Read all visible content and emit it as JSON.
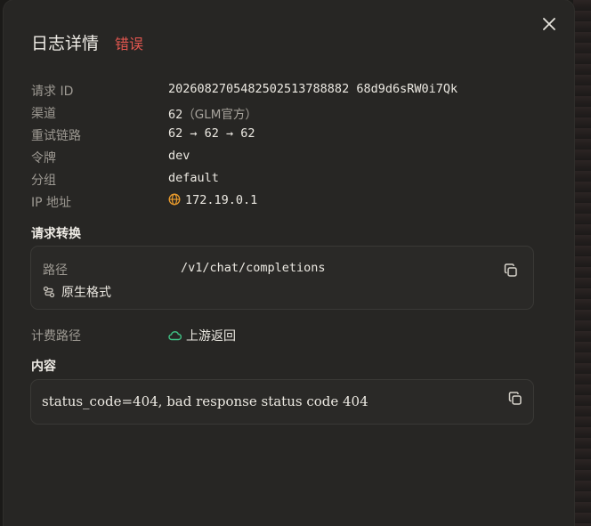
{
  "dialog": {
    "title": "日志详情",
    "status": "错误",
    "colors": {
      "status": "#e0564f",
      "accent_green": "#3fbf83",
      "accent_orange": "#e89a2c"
    }
  },
  "fields": {
    "request_id": {
      "label": "请求 ID",
      "value": "2026082705482502513788882 68d9d6sRW0i7Qk"
    },
    "channel": {
      "label": "渠道",
      "value": "62",
      "suffix": "（GLM官方）"
    },
    "retry_chain": {
      "label": "重试链路",
      "value": "62 → 62 → 62"
    },
    "token": {
      "label": "令牌",
      "value": "dev"
    },
    "group": {
      "label": "分组",
      "value": "default"
    },
    "ip": {
      "label": "IP 地址",
      "value": "172.19.0.1",
      "icon": "globe-icon"
    }
  },
  "request_transform": {
    "title": "请求转换",
    "path_label": "路径",
    "path_value": "/v1/chat/completions",
    "format_label": "原生格式",
    "format_icon": "route-icon",
    "copy_icon": "copy-icon"
  },
  "billing": {
    "label": "计费路径",
    "value": "上游返回",
    "icon": "cloud-icon"
  },
  "content": {
    "title": "内容",
    "text": "status_code=404, bad response status code 404",
    "copy_icon": "copy-icon"
  }
}
